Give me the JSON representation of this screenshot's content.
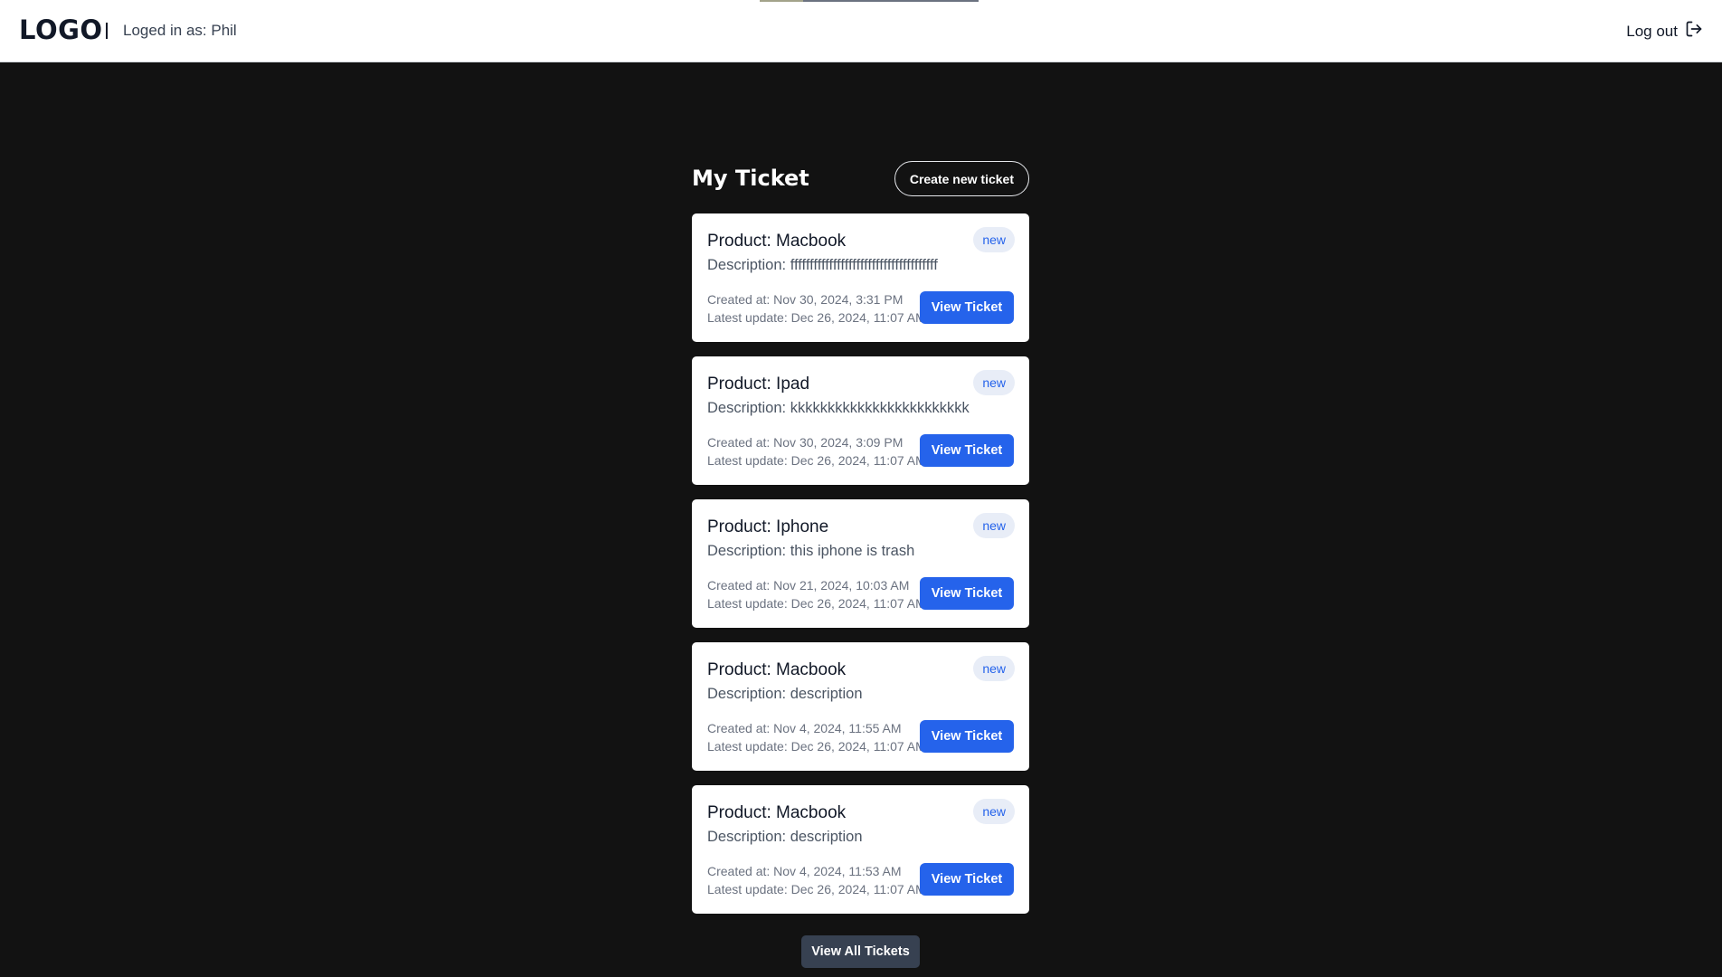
{
  "header": {
    "logo": "LOGO",
    "login_text": "Loged in as: Phil",
    "logout_label": "Log out"
  },
  "main": {
    "title": "My Ticket",
    "create_label": "Create new ticket",
    "view_all_label": "View All Tickets"
  },
  "tickets": [
    {
      "product": "Product: Macbook",
      "status": "new",
      "description": "Description: ffffffffffffffffffffffffffffffffffffff",
      "created": "Created at: Nov 30, 2024, 3:31 PM",
      "updated": "Latest update: Dec 26, 2024, 11:07 AM",
      "button": "View Ticket"
    },
    {
      "product": "Product: Ipad",
      "status": "new",
      "description": "Description: kkkkkkkkkkkkkkkkkkkkkkkk",
      "created": "Created at: Nov 30, 2024, 3:09 PM",
      "updated": "Latest update: Dec 26, 2024, 11:07 AM",
      "button": "View Ticket"
    },
    {
      "product": "Product: Iphone",
      "status": "new",
      "description": "Description: this iphone is trash",
      "created": "Created at: Nov 21, 2024, 10:03 AM",
      "updated": "Latest update: Dec 26, 2024, 11:07 AM",
      "button": "View Ticket"
    },
    {
      "product": "Product: Macbook",
      "status": "new",
      "description": "Description: description",
      "created": "Created at: Nov 4, 2024, 11:55 AM",
      "updated": "Latest update: Dec 26, 2024, 11:07 AM",
      "button": "View Ticket"
    },
    {
      "product": "Product: Macbook",
      "status": "new",
      "description": "Description: description",
      "created": "Created at: Nov 4, 2024, 11:53 AM",
      "updated": "Latest update: Dec 26, 2024, 11:07 AM",
      "button": "View Ticket"
    }
  ],
  "colors": {
    "background": "#121212",
    "accent": "#2563eb",
    "badge_bg": "#e8edf7",
    "view_all_bg": "#374151"
  },
  "icons": {
    "logout": "logout-icon"
  }
}
